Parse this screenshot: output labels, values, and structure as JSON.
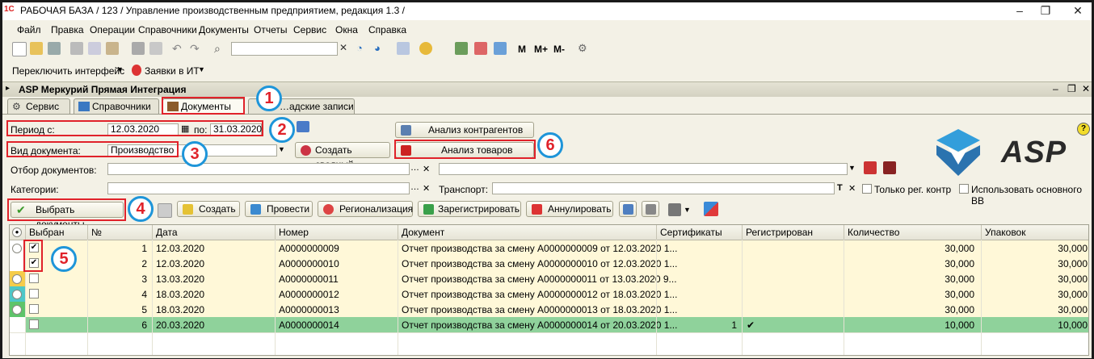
{
  "window": {
    "title": "РАБОЧАЯ БАЗА / 123 /  Управление производственным предприятием, редакция 1.3 /"
  },
  "menu": [
    "Файл",
    "Правка",
    "Операции",
    "Справочники",
    "Документы",
    "Отчеты",
    "Сервис",
    "Окна",
    "Справка"
  ],
  "toolbar": {
    "m_label": "M",
    "mplus_label": "M+",
    "mminus_label": "M-"
  },
  "toolbar2": {
    "switch_interface": "Переключить интерфейс",
    "it_requests": "Заявки в ИТ"
  },
  "panel": {
    "title": "ASP Меркурий Прямая Интеграция",
    "tabs": [
      "Сервис",
      "Справочники",
      "Документы",
      "…адские записи"
    ]
  },
  "filters": {
    "period_label": "Период с:",
    "date_from": "12.03.2020",
    "to_label": "по:",
    "date_to": "31.03.2020",
    "doc_type_label": "Вид документа:",
    "doc_type_value": "Производство",
    "doc_filter_label": "Отбор документов:",
    "categories_label": "Категории:",
    "transport_label": "Транспорт:",
    "only_reg_label": "Только рег. контр",
    "use_main_label": "Использовать основного ВВ"
  },
  "buttons": {
    "counterparty_analysis": "Анализ контрагентов",
    "create_summary": "Создать сводный",
    "goods_analysis": "Анализ товаров",
    "select_docs": "Выбрать документы",
    "create": "Создать",
    "post": "Провести",
    "regionalize": "Регионализация",
    "register": "Зарегистрировать",
    "annul": "Аннулировать"
  },
  "brand": {
    "text": "ASP",
    "color": "#1e95d9"
  },
  "callouts": [
    "1",
    "2",
    "3",
    "4",
    "5",
    "6"
  ],
  "table": {
    "headers": [
      "Выбран",
      "№",
      "Дата",
      "Номер",
      "Документ",
      "Сертификаты",
      "Регистрирован",
      "Количество",
      "Упаковок"
    ],
    "rows": [
      {
        "checked": true,
        "n": "1",
        "date": "12.03.2020",
        "number": "А0000000009",
        "doc": "Отчет производства за смену А0000000009 от 12.03.2020 1...",
        "certs": "",
        "reg": "",
        "qty": "30,000",
        "packs": "30,000"
      },
      {
        "checked": true,
        "n": "2",
        "date": "12.03.2020",
        "number": "А0000000010",
        "doc": "Отчет производства за смену А0000000010 от 12.03.2020 1...",
        "certs": "",
        "reg": "",
        "qty": "30,000",
        "packs": "30,000"
      },
      {
        "checked": false,
        "n": "3",
        "date": "13.03.2020",
        "number": "А0000000011",
        "doc": "Отчет производства за смену А0000000011 от 13.03.2020 9...",
        "certs": "",
        "reg": "",
        "qty": "30,000",
        "packs": "30,000"
      },
      {
        "checked": false,
        "n": "4",
        "date": "18.03.2020",
        "number": "А0000000012",
        "doc": "Отчет производства за смену А0000000012 от 18.03.2020 1...",
        "certs": "",
        "reg": "",
        "qty": "30,000",
        "packs": "30,000"
      },
      {
        "checked": false,
        "n": "5",
        "date": "18.03.2020",
        "number": "А0000000013",
        "doc": "Отчет производства за смену А0000000013 от 18.03.2020 1...",
        "certs": "",
        "reg": "",
        "qty": "30,000",
        "packs": "30,000"
      },
      {
        "checked": false,
        "n": "6",
        "date": "20.03.2020",
        "number": "А0000000014",
        "doc": "Отчет производства за смену А0000000014 от 20.03.2020 1...",
        "certs": "1",
        "reg": "✔",
        "qty": "10,000",
        "packs": "10,000"
      }
    ]
  },
  "colors": {
    "highlight_red": "#e0222a",
    "callout_blue": "#1e95d9",
    "selected_row": "#8fd29b"
  }
}
